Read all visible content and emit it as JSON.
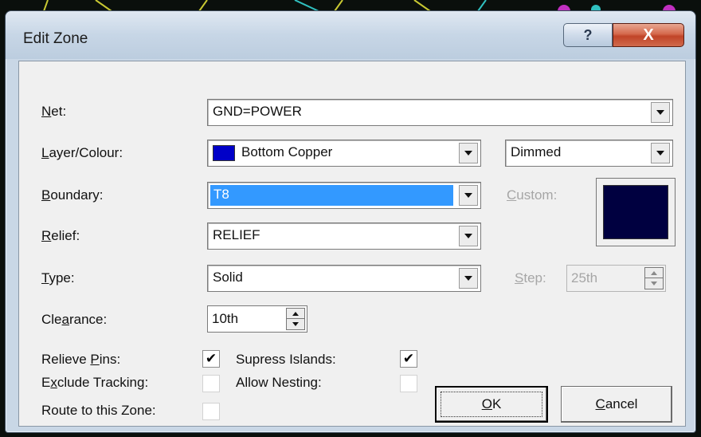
{
  "window": {
    "title": "Edit Zone",
    "help_glyph": "?",
    "close_glyph": "X"
  },
  "form": {
    "net": {
      "label_u": "N",
      "label_rest": "et:",
      "value": "GND=POWER"
    },
    "layer": {
      "label_u": "L",
      "label_rest": "ayer/Colour:",
      "value": "Bottom Copper",
      "swatch_color": "#0000c8"
    },
    "display": {
      "value": "Dimmed"
    },
    "boundary": {
      "label_u": "B",
      "label_rest": "oundary:",
      "value": "T8"
    },
    "custom": {
      "label_u": "C",
      "label_rest": "ustom:",
      "color": "#000040"
    },
    "relief": {
      "label_u": "R",
      "label_rest": "elief:",
      "value": "RELIEF"
    },
    "type": {
      "label_u": "T",
      "label_rest": "ype:",
      "value": "Solid"
    },
    "step": {
      "label_u": "S",
      "label_rest": "tep:",
      "value": "25th"
    },
    "clearance": {
      "label_pre": "Cle",
      "label_u": "a",
      "label_rest": "rance:",
      "value": "10th"
    }
  },
  "options": {
    "relieve_pins": {
      "label_pre": "Relieve ",
      "label_u": "P",
      "label_rest": "ins:",
      "checked": "✔"
    },
    "exclude_tracking": {
      "label_pre": "E",
      "label_u": "x",
      "label_rest": "clude Tracking:",
      "checked": ""
    },
    "route_to_zone": {
      "label": "Route to this Zone:",
      "checked": ""
    },
    "supress_islands": {
      "label": "Supress Islands:",
      "checked": "✔"
    },
    "allow_nesting": {
      "label": "Allow Nesting:",
      "checked": ""
    }
  },
  "buttons": {
    "ok": {
      "u": "O",
      "rest": "K"
    },
    "cancel": {
      "u": "C",
      "rest": "ancel"
    }
  }
}
